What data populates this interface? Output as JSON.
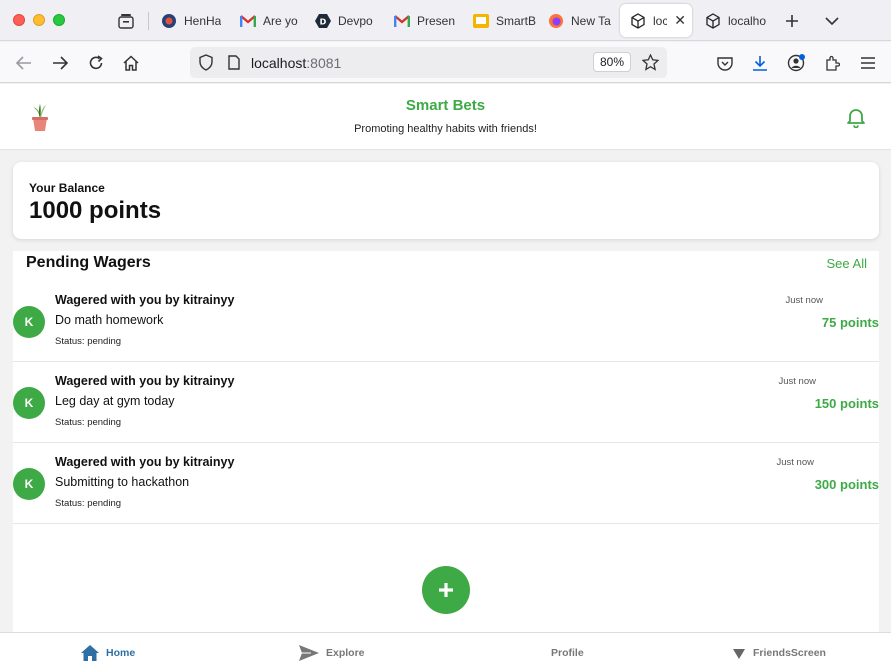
{
  "browser": {
    "tabs": [
      {
        "label": "HenHa",
        "favicon": "globe-icon"
      },
      {
        "label": "Are yo",
        "favicon": "gmail-icon"
      },
      {
        "label": "Devpo",
        "favicon": "devpost-icon"
      },
      {
        "label": "Presen",
        "favicon": "gmail-icon"
      },
      {
        "label": "SmartB",
        "favicon": "slides-icon"
      },
      {
        "label": "New Ta",
        "favicon": "firefox-icon"
      },
      {
        "label": "loca",
        "favicon": "cube-icon",
        "active": true
      },
      {
        "label": "localho",
        "favicon": "cube-icon"
      }
    ],
    "url_host": "localhost",
    "url_port": ":8081",
    "zoom": "80%"
  },
  "app": {
    "title": "Smart Bets",
    "subtitle": "Promoting healthy habits with friends!",
    "accent_color": "#3daa45"
  },
  "balance": {
    "label": "Your Balance",
    "value": "1000 points"
  },
  "pending": {
    "title": "Pending Wagers",
    "see_all": "See All",
    "items": [
      {
        "avatar": "K",
        "title": "Wagered with you by kitrainyy",
        "description": "Do math homework",
        "status": "Status: pending",
        "time": "Just now",
        "points": "75 points"
      },
      {
        "avatar": "K",
        "title": "Wagered with you by kitrainyy",
        "description": "Leg day at gym today",
        "status": "Status: pending",
        "time": "Just now",
        "points": "150 points"
      },
      {
        "avatar": "K",
        "title": "Wagered with you by kitrainyy",
        "description": "Submitting to hackathon",
        "status": "Status: pending",
        "time": "Just now",
        "points": "300 points"
      }
    ]
  },
  "bottom_nav": {
    "items": [
      {
        "label": "Home",
        "icon": "home-icon",
        "active": true
      },
      {
        "label": "Explore",
        "icon": "send-icon"
      },
      {
        "label": "Profile",
        "icon": ""
      },
      {
        "label": "FriendsScreen",
        "icon": "triangle-down-icon"
      }
    ]
  }
}
